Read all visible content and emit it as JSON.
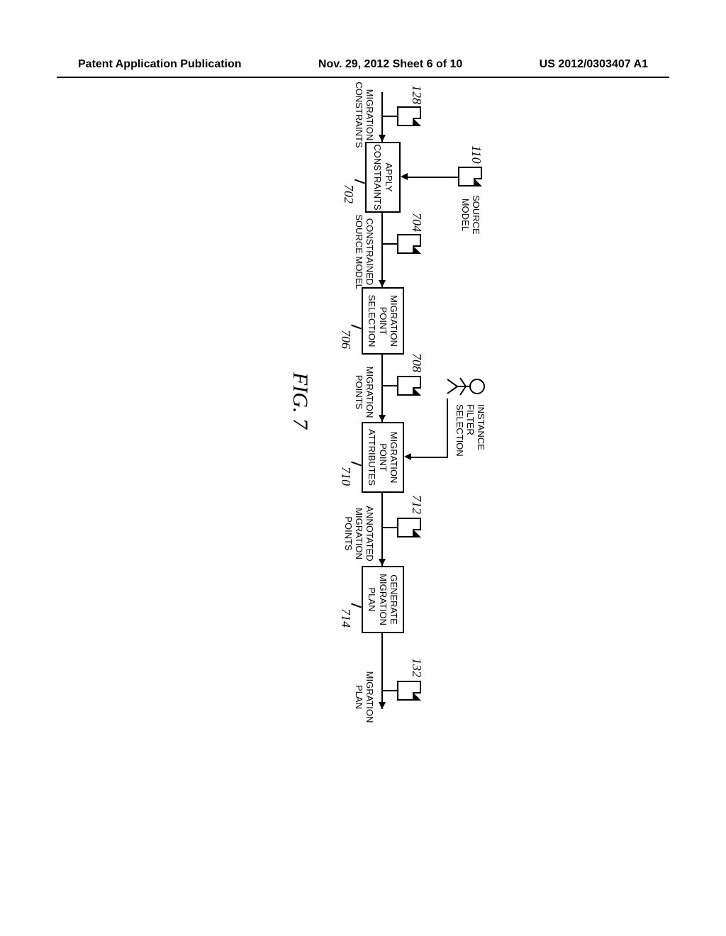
{
  "header": {
    "left": "Patent Application Publication",
    "center": "Nov. 29, 2012  Sheet 6 of 10",
    "right": "US 2012/0303407 A1"
  },
  "figure_label": "FIG. 7",
  "docs": {
    "source_model": {
      "label": "SOURCE\nMODEL",
      "ref": "110"
    },
    "migration_constraints": {
      "label": "MIGRATION\nCONSTRAINTS",
      "ref": "128"
    },
    "constrained_source": {
      "label": "CONSTRAINED\nSOURCE MODEL",
      "ref": "704"
    },
    "migration_points": {
      "label": "MIGRATION\nPOINTS",
      "ref": "708"
    },
    "annotated_points": {
      "label": "ANNOTATED\nMIGRATION\nPOINTS",
      "ref": "712"
    },
    "migration_plan": {
      "label": "MIGRATION\nPLAN",
      "ref": "132"
    }
  },
  "boxes": {
    "apply_constraints": {
      "label": "APPLY\nCONSTRAINTS",
      "ref": "702"
    },
    "migration_point_selection": {
      "label": "MIGRATION\nPOINT\nSELECTION",
      "ref": "706"
    },
    "migration_point_attributes": {
      "label": "MIGRATION\nPOINT\nATTRIBUTES",
      "ref": "710"
    },
    "generate_migration_plan": {
      "label": "GENERATE\nMIGRATION\nPLAN",
      "ref": "714"
    }
  },
  "user_label": "INSTANCE\nFILTER\nSELECTION"
}
